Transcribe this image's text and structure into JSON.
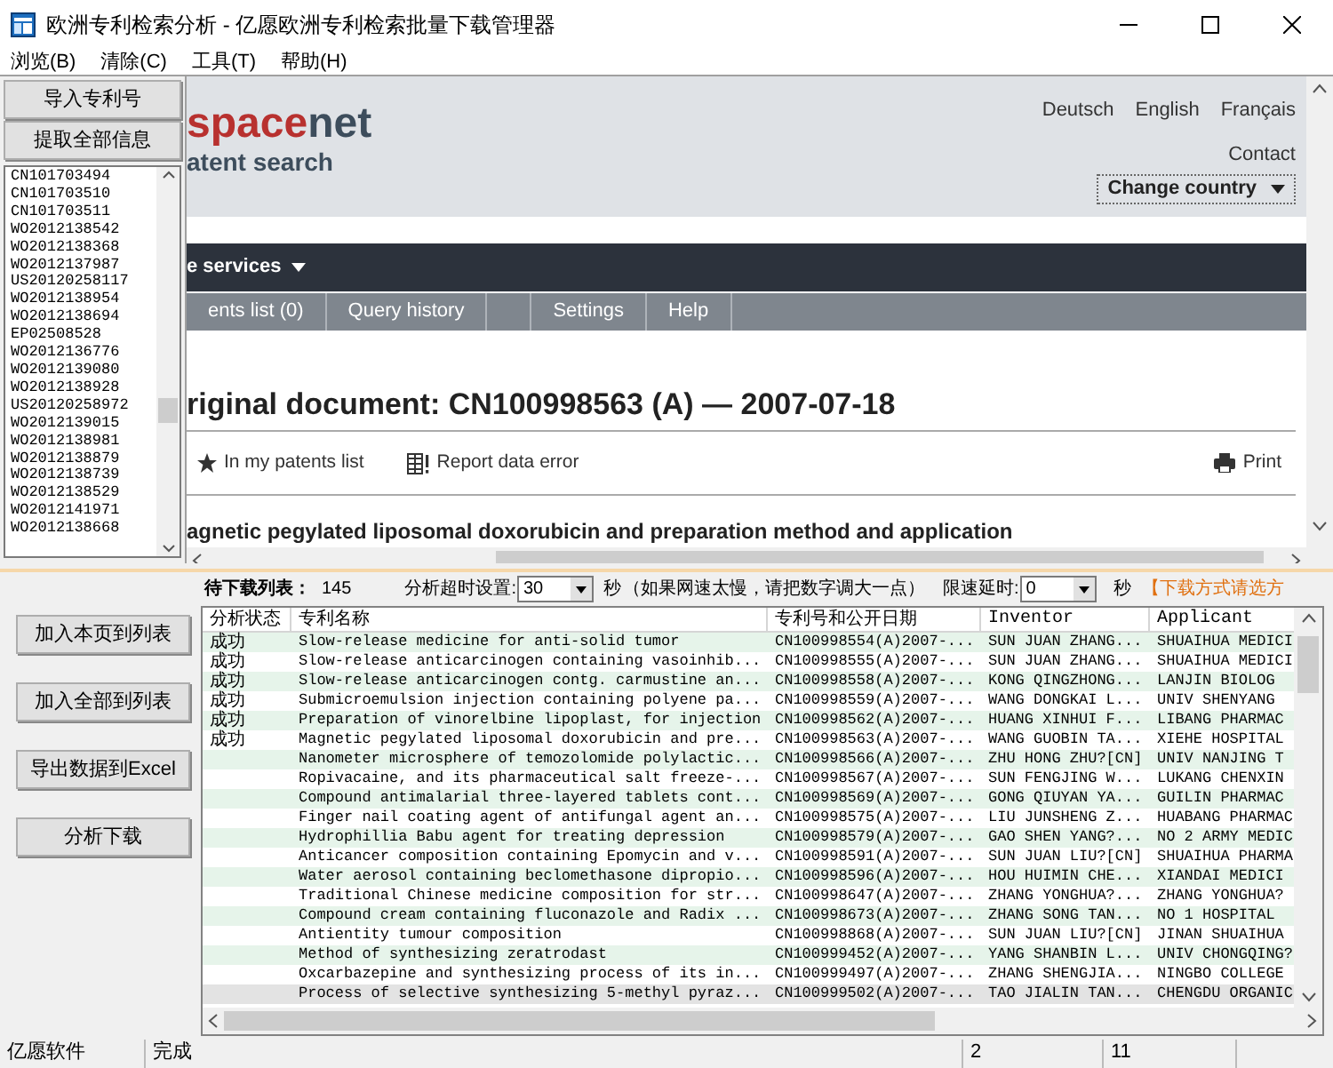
{
  "window": {
    "title": "欧洲专利检索分析 - 亿愿欧洲专利检索批量下载管理器"
  },
  "menu": [
    "浏览(B)",
    "清除(C)",
    "工具(T)",
    "帮助(H)"
  ],
  "left_panel": {
    "buttons": [
      "导入专利号",
      "提取全部信息"
    ],
    "patent_numbers": [
      "CN101703494",
      "CN101703510",
      "CN101703511",
      "WO2012138542",
      "WO2012138368",
      "WO2012137987",
      "US20120258117",
      "WO2012138954",
      "WO2012138694",
      "EP02508528",
      "WO2012136776",
      "WO2012139080",
      "WO2012138928",
      "US20120258972",
      "WO2012139015",
      "WO2012138981",
      "WO2012138879",
      "WO2012138739",
      "WO2012138529",
      "WO2012141971",
      "WO2012138668"
    ]
  },
  "browser": {
    "logo_red": "space",
    "logo_dark": "net",
    "logo_subtitle": "atent search",
    "languages": [
      "Deutsch",
      "English",
      "Français"
    ],
    "contact": "Contact",
    "change_country": "Change country",
    "nav_label": "e services",
    "tabs": [
      {
        "kind": "text",
        "label": "ents list (0)"
      },
      {
        "kind": "text",
        "label": "Query history"
      },
      {
        "kind": "blank"
      },
      {
        "kind": "text",
        "label": "Settings"
      },
      {
        "kind": "text",
        "label": "Help"
      }
    ],
    "heading": "riginal document: CN100998563 (A) — 2007-07-18",
    "actions": [
      {
        "kind": "star",
        "label": "In my patents list"
      },
      {
        "kind": "report",
        "label": "Report data error"
      }
    ],
    "print": "Print",
    "doc_title": "agnetic pegylated liposomal doxorubicin and preparation method and application"
  },
  "toolbar": {
    "queue_label": "待下载列表：",
    "queue_count": "145",
    "timeout_label": "分析超时设置:",
    "timeout_value": "30",
    "timeout_unit": "秒",
    "hint": "（如果网速太慢，请把数字调大一点）",
    "delay_label": "限速延时:",
    "delay_value": "0",
    "delay_unit": "秒",
    "notice": "【下载方式请选方"
  },
  "actions": [
    "加入本页到列表",
    "加入全部到列表",
    "导出数据到Excel",
    "分析下载"
  ],
  "table": {
    "columns": [
      "分析状态",
      "专利名称",
      "专利号和公开日期",
      "Inventor",
      "Applicant"
    ],
    "rows": [
      {
        "status": "成功",
        "name": "Slow-release medicine for anti-solid tumor",
        "number": "CN100998554(A)2007-...",
        "inventor": "SUN JUAN ZHANG...",
        "applicant": "SHUAIHUA MEDICI",
        "selected": false
      },
      {
        "status": "成功",
        "name": "Slow-release anticarcinogen containing vasoinhib...",
        "number": "CN100998555(A)2007-...",
        "inventor": "SUN JUAN ZHANG...",
        "applicant": "SHUAIHUA MEDICI",
        "selected": false
      },
      {
        "status": "成功",
        "name": "Slow-release anticarcinogen contg. carmustine an...",
        "number": "CN100998558(A)2007-...",
        "inventor": "KONG QINGZHONG...",
        "applicant": "LANJIN BIOLOG",
        "selected": false
      },
      {
        "status": "成功",
        "name": "Submicroemulsion injection containing polyene pa...",
        "number": "CN100998559(A)2007-...",
        "inventor": "WANG DONGKAI L...",
        "applicant": "UNIV SHENYANG",
        "selected": false
      },
      {
        "status": "成功",
        "name": "Preparation of vinorelbine lipoplast, for injection",
        "number": "CN100998562(A)2007-...",
        "inventor": "HUANG XINHUI F...",
        "applicant": "LIBANG PHARMAC",
        "selected": false
      },
      {
        "status": "成功",
        "name": "Magnetic pegylated liposomal doxorubicin and pre...",
        "number": "CN100998563(A)2007-...",
        "inventor": "WANG GUOBIN TA...",
        "applicant": "XIEHE HOSPITAL",
        "selected": false
      },
      {
        "name": "Nanometer microsphere of temozolomide polylactic...",
        "number": "CN100998566(A)2007-...",
        "inventor": "ZHU HONG ZHU?[CN]",
        "applicant": "UNIV NANJING T",
        "selected": false
      },
      {
        "name": "Ropivacaine, and its pharmaceutical salt freeze-...",
        "number": "CN100998567(A)2007-...",
        "inventor": "SUN FENGJING W...",
        "applicant": "LUKANG CHENXIN",
        "selected": false
      },
      {
        "name": "Compound antimalarial three-layered tablets cont...",
        "number": "CN100998569(A)2007-...",
        "inventor": "GONG QIUYAN YA...",
        "applicant": "GUILIN PHARMAC",
        "selected": false
      },
      {
        "name": "Finger nail coating agent of antifungal agent an...",
        "number": "CN100998575(A)2007-...",
        "inventor": "LIU JUNSHENG Z...",
        "applicant": "HUABANG PHARMAC",
        "selected": false
      },
      {
        "name": "Hydrophillia Babu agent for treating depression",
        "number": "CN100998579(A)2007-...",
        "inventor": "GAO SHEN YANG?...",
        "applicant": "NO 2 ARMY MEDIC",
        "selected": false
      },
      {
        "name": "Anticancer composition containing Epomycin and v...",
        "number": "CN100998591(A)2007-...",
        "inventor": "SUN JUAN LIU?[CN]",
        "applicant": "SHUAIHUA PHARMA",
        "selected": false
      },
      {
        "name": "Water aerosol containing beclomethasone dipropio...",
        "number": "CN100998596(A)2007-...",
        "inventor": "HOU HUIMIN CHE...",
        "applicant": "XIANDAI MEDICI",
        "selected": false
      },
      {
        "name": "Traditional Chinese medicine composition for str...",
        "number": "CN100998647(A)2007-...",
        "inventor": "ZHANG YONGHUA?...",
        "applicant": "ZHANG YONGHUA?",
        "selected": false
      },
      {
        "name": "Compound cream containing fluconazole and Radix ...",
        "number": "CN100998673(A)2007-...",
        "inventor": "ZHANG SONG TAN...",
        "applicant": "NO 1 HOSPITAL",
        "selected": false
      },
      {
        "name": "Antientity tumour composition",
        "number": "CN100998868(A)2007-...",
        "inventor": "SUN JUAN LIU?[CN]",
        "applicant": "JINAN SHUAIHUA",
        "selected": false
      },
      {
        "name": "Method of synthesizing zeratrodast",
        "number": "CN100999452(A)2007-...",
        "inventor": "YANG SHANBIN L...",
        "applicant": "UNIV CHONGQING?",
        "selected": false
      },
      {
        "name": "Oxcarbazepine and synthesizing process of its in...",
        "number": "CN100999497(A)2007-...",
        "inventor": "ZHANG SHENGJIA...",
        "applicant": "NINGBO COLLEGE",
        "selected": false
      },
      {
        "name": "Process of selective synthesizing 5-methyl pyraz...",
        "number": "CN100999502(A)2007-...",
        "inventor": "TAO JIALIN TAN...",
        "applicant": "CHENGDU ORGANIC",
        "selected": true
      }
    ]
  },
  "status_bar": [
    "亿愿软件",
    "完成",
    "2",
    "11"
  ]
}
